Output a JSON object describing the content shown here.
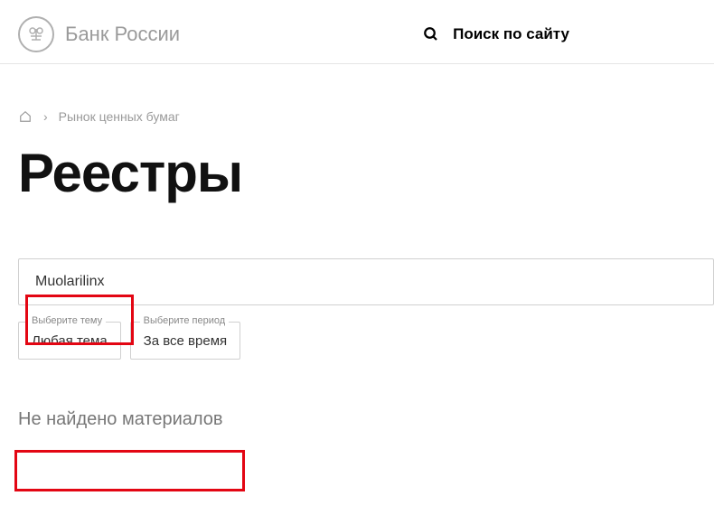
{
  "header": {
    "site_name": "Банк России",
    "search_label": "Поиск по сайту"
  },
  "breadcrumb": {
    "separator": "›",
    "item": "Рынок ценных бумаг"
  },
  "page": {
    "title": "Реестры"
  },
  "search": {
    "value": "Muolarilinx"
  },
  "filters": {
    "theme": {
      "label": "Выберите тему",
      "value": "Любая тема"
    },
    "period": {
      "label": "Выберите период",
      "value": "За все время"
    }
  },
  "result": {
    "message": "Не найдено материалов"
  }
}
